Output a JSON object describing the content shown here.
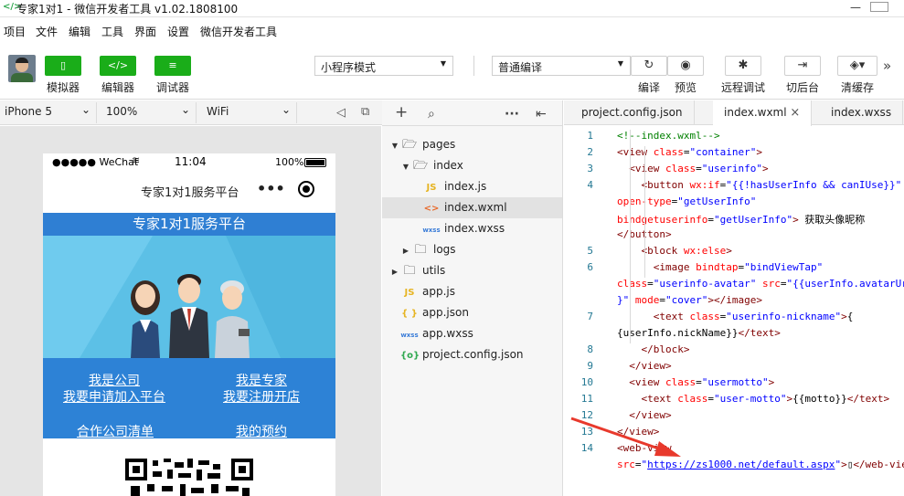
{
  "window": {
    "title": "专家1对1 - 微信开发者工具 v1.02.1808100",
    "minimize": "—",
    "maximize": "□"
  },
  "menu": [
    "项目",
    "文件",
    "编辑",
    "工具",
    "界面",
    "设置",
    "微信开发者工具"
  ],
  "toolbar": {
    "simulator_label": "模拟器",
    "editor_label": "编辑器",
    "debugger_label": "调试器",
    "mode_select": "小程序模式",
    "compile_select": "普通编译",
    "compile_label": "编译",
    "preview_label": "预览",
    "remote_debug_label": "远程调试",
    "background_label": "切后台",
    "clear_cache_label": "清缓存",
    "more": "»"
  },
  "device_bar": {
    "device": "iPhone 5",
    "zoom": "100%",
    "network": "WiFi"
  },
  "phone": {
    "carrier": "●●●●● WeChat",
    "time": "11:04",
    "battery": "100%",
    "nav_title": "专家1对1服务平台",
    "nav_dots": "•••",
    "hero_title": "专家1对1服务平台",
    "links": {
      "company": "我是公司",
      "company_join": "我要申请加入平台",
      "expert": "我是专家",
      "expert_open": "我要注册开店",
      "company_list": "合作公司清单",
      "my_booking": "我的预约"
    }
  },
  "file_tree": [
    {
      "name": "pages",
      "type": "folder",
      "expanded": true,
      "level": 0
    },
    {
      "name": "index",
      "type": "folder",
      "expanded": true,
      "level": 1
    },
    {
      "name": "index.js",
      "type": "js",
      "level": 2
    },
    {
      "name": "index.wxml",
      "type": "wxml",
      "level": 2,
      "selected": true
    },
    {
      "name": "index.wxss",
      "type": "wxss",
      "level": 2
    },
    {
      "name": "logs",
      "type": "folder",
      "expanded": false,
      "level": 1
    },
    {
      "name": "utils",
      "type": "folder",
      "expanded": false,
      "level": 0
    },
    {
      "name": "app.js",
      "type": "js",
      "level": 0
    },
    {
      "name": "app.json",
      "type": "json",
      "level": 0
    },
    {
      "name": "app.wxss",
      "type": "wxss",
      "level": 0
    },
    {
      "name": "project.config.json",
      "type": "config",
      "level": 0
    }
  ],
  "file_icons": {
    "js": "JS",
    "wxml": "<>",
    "wxss": "wxss",
    "json": "{ }",
    "config": "{o}"
  },
  "tabs": [
    {
      "label": "project.config.json",
      "active": false
    },
    {
      "label": "index.wxml",
      "active": true,
      "close": "×"
    },
    {
      "label": "index.wxss",
      "active": false
    }
  ],
  "code_lines": [
    {
      "n": "1",
      "tokens": [
        [
          "cm",
          "<!--index.wxml-->"
        ]
      ]
    },
    {
      "n": "2",
      "tokens": [
        [
          "tg",
          "<view "
        ],
        [
          "at",
          "class"
        ],
        [
          "tx",
          "="
        ],
        [
          "vl",
          "\"container\""
        ],
        [
          "tg",
          ">"
        ]
      ]
    },
    {
      "n": "3",
      "tokens": [
        [
          "tx",
          "  "
        ],
        [
          "tg",
          "<view "
        ],
        [
          "at",
          "class"
        ],
        [
          "tx",
          "="
        ],
        [
          "vl",
          "\"userinfo\""
        ],
        [
          "tg",
          ">"
        ]
      ]
    },
    {
      "n": "4",
      "tokens": [
        [
          "tx",
          "    "
        ],
        [
          "tg",
          "<button "
        ],
        [
          "at",
          "wx:if"
        ],
        [
          "tx",
          "="
        ],
        [
          "vl",
          "\"{{!hasUserInfo && canIUse}}\""
        ]
      ]
    },
    {
      "n": "",
      "tokens": [
        [
          "at",
          "open-type"
        ],
        [
          "tx",
          "="
        ],
        [
          "vl",
          "\"getUserInfo\""
        ]
      ]
    },
    {
      "n": "",
      "tokens": [
        [
          "at",
          "bindgetuserinfo"
        ],
        [
          "tx",
          "="
        ],
        [
          "vl",
          "\"getUserInfo\""
        ],
        [
          "tg",
          ">"
        ],
        [
          "tx",
          " 获取头像昵称"
        ]
      ]
    },
    {
      "n": "",
      "tokens": [
        [
          "tg",
          "</button>"
        ]
      ]
    },
    {
      "n": "5",
      "tokens": [
        [
          "tx",
          "    "
        ],
        [
          "tg",
          "<block "
        ],
        [
          "at",
          "wx:else"
        ],
        [
          "tg",
          ">"
        ]
      ]
    },
    {
      "n": "6",
      "tokens": [
        [
          "tx",
          "      "
        ],
        [
          "tg",
          "<image "
        ],
        [
          "at",
          "bindtap"
        ],
        [
          "tx",
          "="
        ],
        [
          "vl",
          "\"bindViewTap\""
        ]
      ]
    },
    {
      "n": "",
      "tokens": [
        [
          "at",
          "class"
        ],
        [
          "tx",
          "="
        ],
        [
          "vl",
          "\"userinfo-avatar\""
        ],
        [
          "tx",
          " "
        ],
        [
          "at",
          "src"
        ],
        [
          "tx",
          "="
        ],
        [
          "vl",
          "\"{{userInfo.avatarUrl}"
        ]
      ]
    },
    {
      "n": "",
      "tokens": [
        [
          "vl",
          "}\""
        ],
        [
          "tx",
          " "
        ],
        [
          "at",
          "mode"
        ],
        [
          "tx",
          "="
        ],
        [
          "vl",
          "\"cover\""
        ],
        [
          "tg",
          "></image>"
        ]
      ]
    },
    {
      "n": "7",
      "tokens": [
        [
          "tx",
          "      "
        ],
        [
          "tg",
          "<text "
        ],
        [
          "at",
          "class"
        ],
        [
          "tx",
          "="
        ],
        [
          "vl",
          "\"userinfo-nickname\""
        ],
        [
          "tg",
          ">"
        ],
        [
          "tx",
          "{"
        ]
      ]
    },
    {
      "n": "",
      "tokens": [
        [
          "tx",
          "{userInfo.nickName}}"
        ],
        [
          "tg",
          "</text>"
        ]
      ]
    },
    {
      "n": "8",
      "tokens": [
        [
          "tx",
          "    "
        ],
        [
          "tg",
          "</block>"
        ]
      ]
    },
    {
      "n": "9",
      "tokens": [
        [
          "tx",
          "  "
        ],
        [
          "tg",
          "</view>"
        ]
      ]
    },
    {
      "n": "10",
      "tokens": [
        [
          "tx",
          "  "
        ],
        [
          "tg",
          "<view "
        ],
        [
          "at",
          "class"
        ],
        [
          "tx",
          "="
        ],
        [
          "vl",
          "\"usermotto\""
        ],
        [
          "tg",
          ">"
        ]
      ]
    },
    {
      "n": "11",
      "tokens": [
        [
          "tx",
          "    "
        ],
        [
          "tg",
          "<text "
        ],
        [
          "at",
          "class"
        ],
        [
          "tx",
          "="
        ],
        [
          "vl",
          "\"user-motto\""
        ],
        [
          "tg",
          ">"
        ],
        [
          "tx",
          "{{motto}}"
        ],
        [
          "tg",
          "</text>"
        ]
      ]
    },
    {
      "n": "12",
      "tokens": [
        [
          "tx",
          "  "
        ],
        [
          "tg",
          "</view>"
        ]
      ]
    },
    {
      "n": "13",
      "tokens": [
        [
          "tg",
          "</view>"
        ]
      ]
    },
    {
      "n": "14",
      "tokens": [
        [
          "tg",
          "<web-view"
        ]
      ]
    },
    {
      "n": "",
      "tokens": [
        [
          "at",
          "src"
        ],
        [
          "tx",
          "="
        ],
        [
          "vl",
          "\""
        ],
        [
          "ul",
          "https://zs1000.net/default.aspx"
        ],
        [
          "vl",
          "\""
        ],
        [
          "tg",
          ">"
        ],
        [
          "tx",
          "▯"
        ],
        [
          "tg",
          "</web-view>"
        ]
      ]
    }
  ],
  "colors": {
    "accent_green": "#1aad19",
    "hero_blue": "#2f7fd3",
    "annotation_red": "#e8392c"
  }
}
